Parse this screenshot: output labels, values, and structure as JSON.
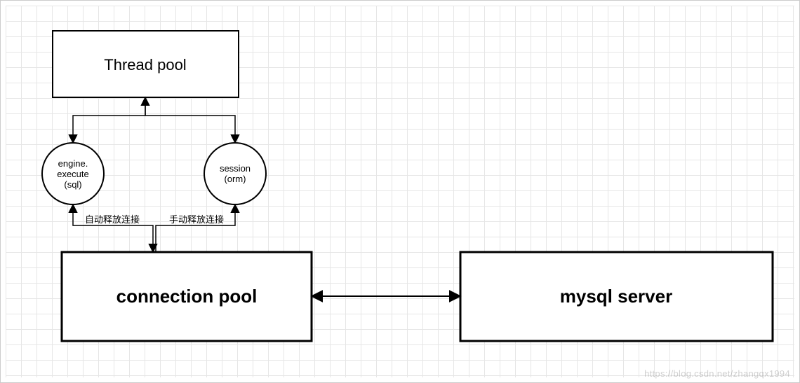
{
  "nodes": {
    "thread_pool": {
      "label": "Thread pool"
    },
    "engine_execute": {
      "line1": "engine.",
      "line2": "execute",
      "line3": "(sql)"
    },
    "session_orm": {
      "line1": "session",
      "line2": "(orm)"
    },
    "connection_pool": {
      "label": "connection pool"
    },
    "mysql_server": {
      "label": "mysql server"
    }
  },
  "edges": {
    "auto_release": {
      "label": "自动释放连接"
    },
    "manual_release": {
      "label": "手动释放连接"
    }
  },
  "watermark": "https://blog.csdn.net/zhangqx1994",
  "chart_data": {
    "type": "diagram",
    "title": "",
    "nodes": [
      {
        "id": "thread_pool",
        "label": "Thread pool",
        "shape": "rectangle"
      },
      {
        "id": "engine_execute",
        "label": "engine.execute(sql)",
        "shape": "circle"
      },
      {
        "id": "session_orm",
        "label": "session (orm)",
        "shape": "circle"
      },
      {
        "id": "connection_pool",
        "label": "connection pool",
        "shape": "rectangle"
      },
      {
        "id": "mysql_server",
        "label": "mysql server",
        "shape": "rectangle"
      }
    ],
    "edges": [
      {
        "from": "thread_pool",
        "to": "engine_execute",
        "direction": "bidirectional",
        "label": ""
      },
      {
        "from": "thread_pool",
        "to": "session_orm",
        "direction": "bidirectional",
        "label": ""
      },
      {
        "from": "connection_pool",
        "to": "engine_execute",
        "direction": "bidirectional",
        "label": "自动释放连接"
      },
      {
        "from": "connection_pool",
        "to": "session_orm",
        "direction": "bidirectional",
        "label": "手动释放连接"
      },
      {
        "from": "connection_pool",
        "to": "mysql_server",
        "direction": "bidirectional",
        "label": ""
      }
    ]
  }
}
